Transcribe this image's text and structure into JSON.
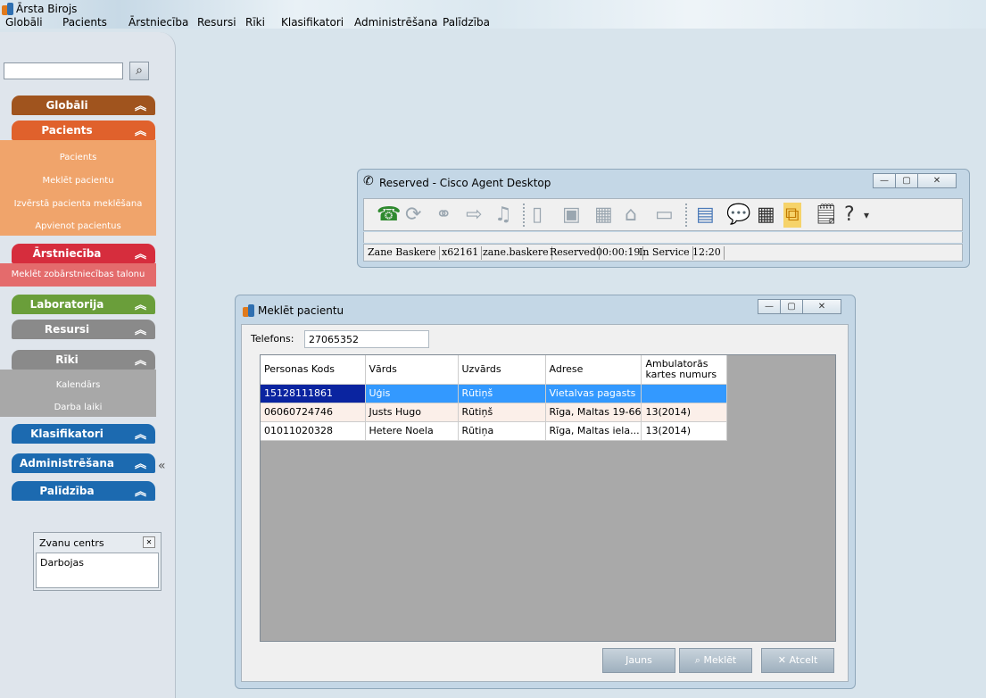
{
  "app": {
    "title": "Ārsta Birojs",
    "menu": [
      "Globāli",
      "Pacients",
      "Ārstniecība",
      "Resursi",
      "Rīki",
      "Klasifikatori",
      "Administrēšana",
      "Palīdzība"
    ]
  },
  "sidebar": {
    "search_value": "",
    "sections": [
      {
        "label": "Globāli",
        "color": "#a0541e"
      },
      {
        "label": "Pacients",
        "color": "#e0612c",
        "items": [
          "Pacients",
          "Meklēt pacientu",
          "Izvērstā pacienta meklēšana",
          "Apvienot pacientus"
        ],
        "items_bg": "#f0a46b"
      },
      {
        "label": "Ārstniecība",
        "color": "#d62d3d",
        "items": [
          "Meklēt zobārstniecības talonu"
        ],
        "items_bg": "#e46b6c"
      },
      {
        "label": "Laboratorija",
        "color": "#6a9e3a"
      },
      {
        "label": "Resursi",
        "color": "#8a8a8a"
      },
      {
        "label": "Rīki",
        "color": "#8a8a8a",
        "items": [
          "Kalendārs",
          "Darba laiki"
        ],
        "items_bg": "#a8a8a8"
      },
      {
        "label": "Klasifikatori",
        "color": "#1c6ab0"
      },
      {
        "label": "Administrēšana",
        "color": "#1c6ab0"
      },
      {
        "label": "Palīdzība",
        "color": "#1c6ab0"
      }
    ],
    "collapse_glyph": "«",
    "call_center": {
      "title": "Zvanu centrs",
      "status": "Darbojas"
    }
  },
  "cisco": {
    "title": "Reserved - Cisco Agent Desktop",
    "status": [
      "Zane Baskere",
      "x62161",
      "zane.baskere",
      "Reserved",
      "00:00:19",
      "In Service",
      "12:20"
    ]
  },
  "dialog": {
    "title": "Meklēt pacientu",
    "phone_label": "Telefons:",
    "phone_value": "27065352",
    "columns": [
      "Personas Kods",
      "Vārds",
      "Uzvārds",
      "Adrese",
      "Ambulatorās kartes numurs"
    ],
    "rows": [
      [
        "15128111861",
        "Uģis",
        "Rūtiņš",
        "Vietalvas pagasts",
        ""
      ],
      [
        "06060724746",
        "Justs Hugo",
        "Rūtiņš",
        "Rīga, Maltas 19-66",
        "13(2014)"
      ],
      [
        "01011020328",
        "Hetere Noela",
        "Rūtiņa",
        "Rīga, Maltas iela...",
        "13(2014)"
      ]
    ],
    "buttons": {
      "new": "Jauns",
      "search": "Meklēt",
      "cancel": "Atcelt"
    }
  }
}
